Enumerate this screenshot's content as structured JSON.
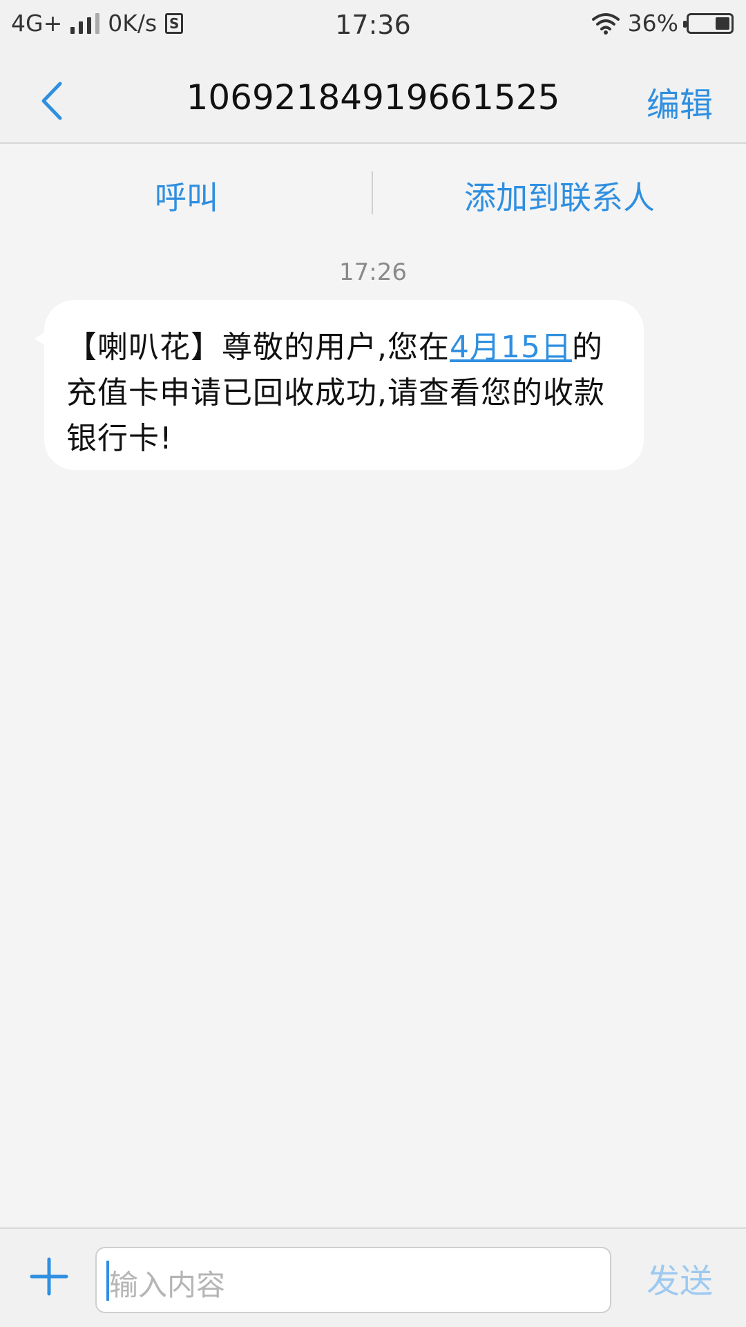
{
  "status_bar": {
    "network": "4G+",
    "speed": "0K/s",
    "sim_badge": "S",
    "time": "17:36",
    "battery_percent": "36%",
    "battery_level": 0.36
  },
  "nav": {
    "title": "10692184919661525",
    "edit_label": "编辑"
  },
  "actions": {
    "call_label": "呼叫",
    "add_contact_label": "添加到联系人"
  },
  "conversation": {
    "timestamp": "17:26",
    "message": {
      "text_before": "【喇叭花】尊敬的用户,您在",
      "link_text": "4月15日",
      "text_after": "的充值卡申请已回收成功,请查看您的收款银行卡!"
    }
  },
  "compose": {
    "placeholder": "输入内容",
    "send_label": "发送"
  },
  "colors": {
    "accent": "#2f8fe0",
    "send_disabled": "#9ec9f0",
    "background": "#f4f4f4"
  }
}
